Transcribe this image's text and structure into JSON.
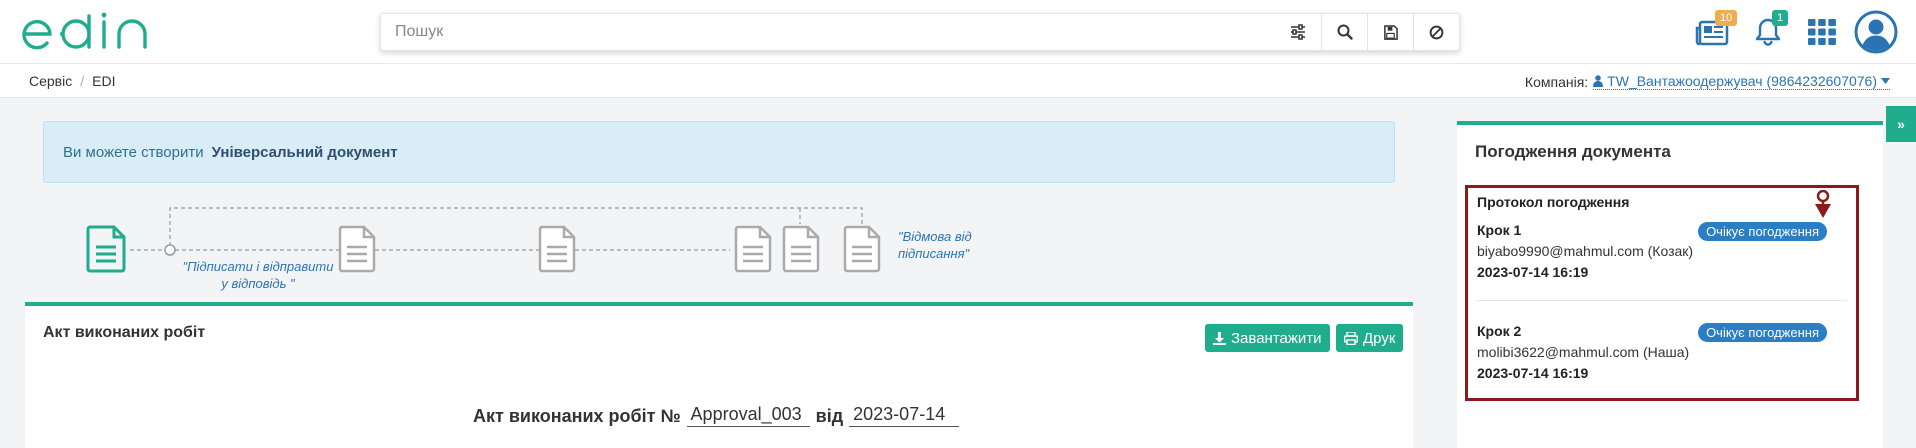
{
  "app": {
    "logo_text": "edin",
    "brand_color": "#1fad8d",
    "link_color": "#2b74b4"
  },
  "search": {
    "placeholder": "Пошук"
  },
  "header": {
    "news_badge": "10",
    "notifications_badge": "1"
  },
  "breadcrumb": {
    "items": [
      "Сервіс",
      "EDI"
    ],
    "separator": "/"
  },
  "company": {
    "label": "Компанія:",
    "name": "TW_Вантажоодержувач (9864232607076)"
  },
  "info_banner": {
    "text": "Ви можете створити",
    "link": "Універсальний документ"
  },
  "workflow": {
    "label_sign": "\"Підписати і відправити у відповідь \"",
    "label_sign_line1": "\"Підписати і відправити",
    "label_sign_line2": "у відповідь \"",
    "label_reject_line1": "\"Відмова від",
    "label_reject_line2": "підписання\""
  },
  "document": {
    "title": "Акт виконаних робіт",
    "download_label": "Завантажити",
    "print_label": "Друк",
    "header_prefix": "Акт виконаних робіт №",
    "number": "Approval_003",
    "from_label": "від",
    "date": "2023-07-14"
  },
  "approval": {
    "title": "Погодження документа",
    "protocol_title": "Протокол погодження",
    "steps": [
      {
        "title": "Крок 1",
        "status": "Очікує погодження",
        "email": "biyabo9990@mahmul.com (Козак)",
        "date": "2023-07-14 16:19"
      },
      {
        "title": "Крок 2",
        "status": "Очікує погодження",
        "email": "molibi3622@mahmul.com (Наша)",
        "date": "2023-07-14 16:19"
      }
    ]
  }
}
